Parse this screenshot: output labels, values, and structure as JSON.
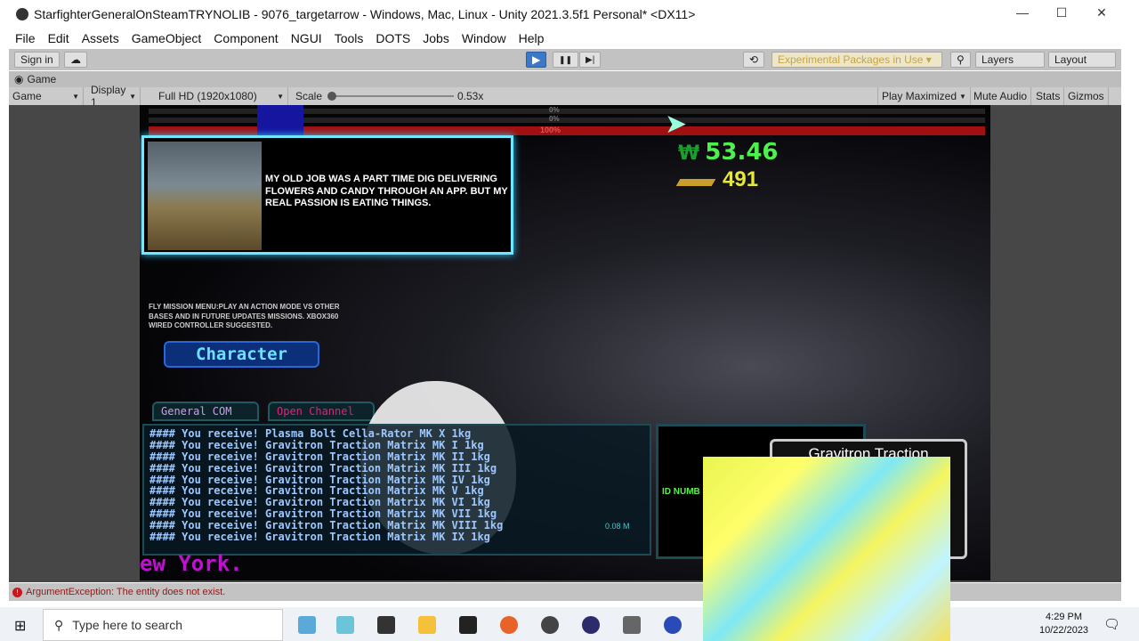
{
  "window": {
    "title": "StarfighterGeneralOnSteamTRYNOLIB - 9076_targetarrow - Windows, Mac, Linux - Unity 2021.3.5f1 Personal* <DX11>",
    "minimize": "—",
    "maximize": "☐",
    "close": "✕"
  },
  "menu": [
    "File",
    "Edit",
    "Assets",
    "GameObject",
    "Component",
    "NGUI",
    "Tools",
    "DOTS",
    "Jobs",
    "Window",
    "Help"
  ],
  "toolbar": {
    "sign_in": "Sign in",
    "cloud_icon": "☁",
    "play": "▶",
    "pause": "❚❚",
    "step": "▶|",
    "history_icon": "⟲",
    "experimental": "Experimental Packages in Use ▾",
    "search_icon": "⚲",
    "layers": "Layers",
    "layout": "Layout"
  },
  "game_tab": {
    "label": "Game"
  },
  "game_toolbar": {
    "view": "Game",
    "display": "Display 1",
    "resolution": "Full HD (1920x1080)",
    "scale_label": "Scale",
    "scale_value": "0.53x",
    "scale_fraction": 0.0,
    "play_maximized": "Play Maximized",
    "mute_audio": "Mute Audio",
    "stats": "Stats",
    "gizmos": "Gizmos"
  },
  "game": {
    "hud_bars": [
      "0%",
      "0%",
      "100%"
    ],
    "score": "53.46",
    "credits": "491",
    "dialog": "MY OLD JOB WAS A PART TIME DIG DELIVERING FLOWERS AND CANDY THROUGH AN APP.  BUT MY REAL PASSION IS EATING THINGS.",
    "fly_mission": "FLY MISSION MENU:PLAY AN ACTION MODE VS OTHER BASES AND IN FUTURE UPDATES MISSIONS. XBOX360 WIRED CONTROLLER SUGGESTED.",
    "character_button": "Character",
    "com_tabs": [
      "General COM",
      "Open Channel"
    ],
    "com_lines": [
      "#### You receive! Plasma Bolt Cella-Rator MK X 1kg",
      "#### You receive! Gravitron Traction Matrix MK I 1kg",
      "#### You receive! Gravitron Traction Matrix MK II 1kg",
      "#### You receive! Gravitron Traction Matrix MK III 1kg",
      "#### You receive! Gravitron Traction Matrix MK IV 1kg",
      "#### You receive! Gravitron Traction Matrix MK V 1kg",
      "#### You receive! Gravitron Traction Matrix MK VI 1kg",
      "#### You receive! Gravitron Traction Matrix MK VII 1kg",
      "#### You receive! Gravitron Traction Matrix MK VIII 1kg",
      "#### You receive! Gravitron Traction Matrix MK IX 1kg"
    ],
    "speed": "0.08 M",
    "id_label": "ID NUMB",
    "item_card_title": "Gravitron Traction",
    "bottom_text": "ew York."
  },
  "status": {
    "error": "ArgumentException: The entity does not exist.",
    "error_icon": "!"
  },
  "taskbar": {
    "search_placeholder": "Type here to search",
    "time": "4:29 PM",
    "date": "10/22/2023"
  }
}
